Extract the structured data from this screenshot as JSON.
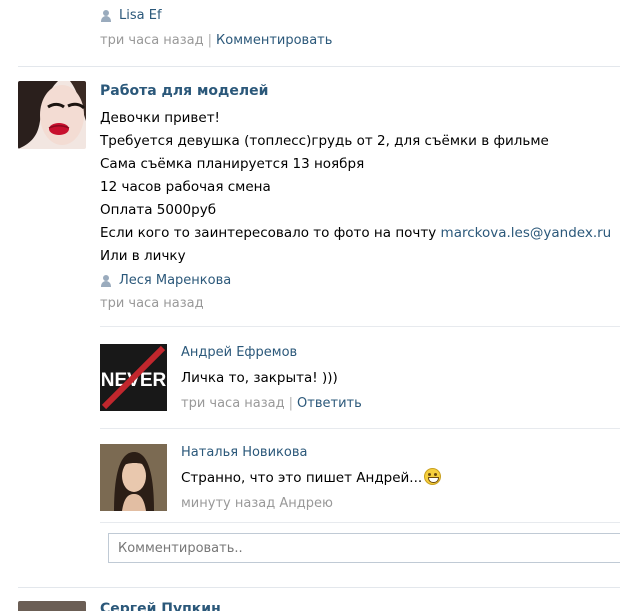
{
  "top_post": {
    "author": "Lisa Ef",
    "time": "три часа назад",
    "comment_link": "Комментировать"
  },
  "post": {
    "title": "Работа для моделей",
    "lines": [
      "Девочки привет!",
      "Требуется девушка (топлесс)грудь от 2, для съёмки в фильме",
      "Сама съёмка планируется 13 ноября",
      "12 часов рабочая смена",
      "Оплата 5000руб"
    ],
    "email_prefix": "Если кого то заинтересовало то фото на почту",
    "email": "marckova.les@yandex.ru",
    "last_line": "Или в личку",
    "author": "Леся Маренкова",
    "time": "три часа назад"
  },
  "replies": [
    {
      "name": "Андрей Ефремов",
      "avatar_text": "NEVER",
      "text": "Личка то, закрыта! )))",
      "time": "три часа назад",
      "reply_link": "Ответить"
    },
    {
      "name": "Наталья Новикова",
      "text": "Странно, что это пишет Андрей...",
      "emoji": "smile-icon",
      "time": "минуту назад",
      "reply_to": "Андрею"
    }
  ],
  "comment_input": {
    "placeholder": "Комментировать.."
  },
  "next_post": {
    "title": "Сергей Пупкин"
  },
  "colors": {
    "link": "#2b587a",
    "muted": "#999999",
    "divider": "#e3e7ec"
  }
}
